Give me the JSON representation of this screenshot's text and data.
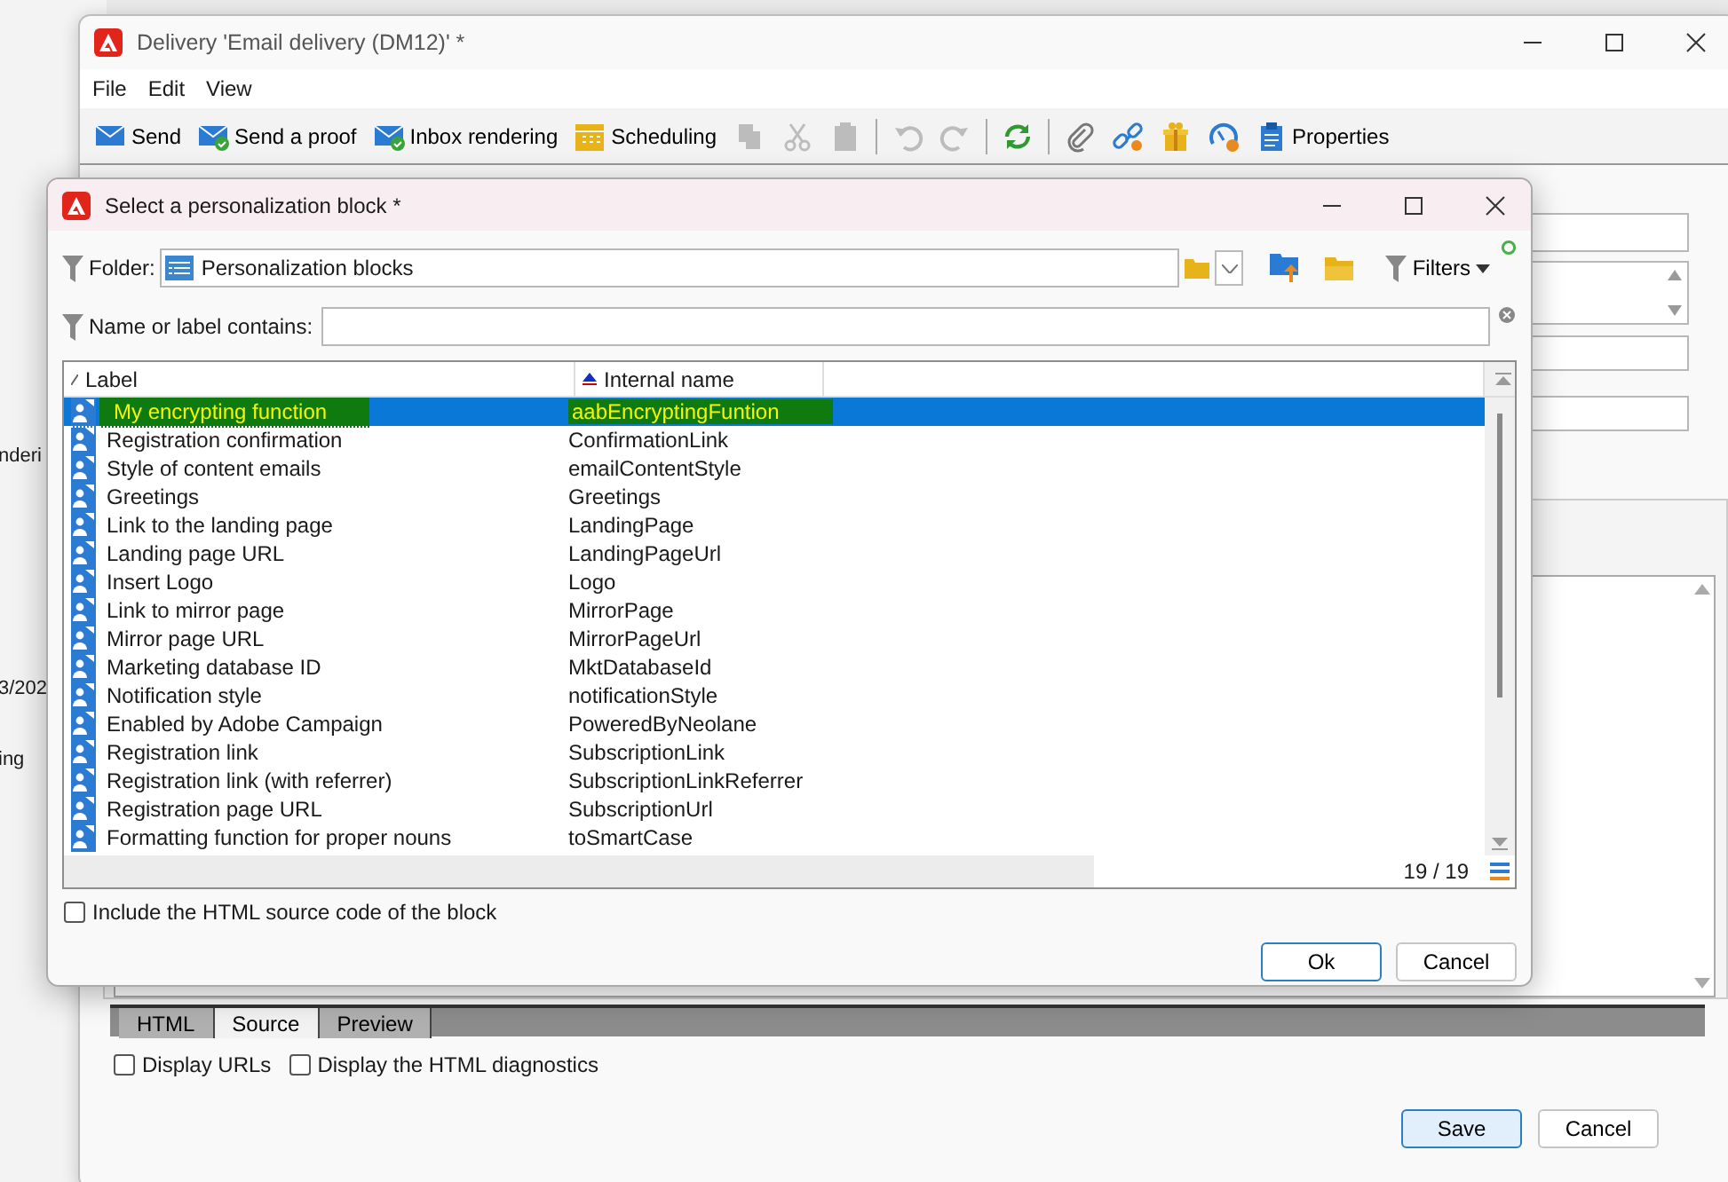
{
  "left_window": {
    "fragments": [
      "nderi",
      "3/202",
      "ing"
    ]
  },
  "main_window": {
    "title": "Delivery 'Email delivery (DM12)' *",
    "menu": [
      "File",
      "Edit",
      "View"
    ],
    "toolbar": [
      {
        "kind": "send",
        "label": "Send",
        "disabled": false
      },
      {
        "kind": "proof",
        "label": "Send a proof",
        "disabled": false
      },
      {
        "kind": "inbox",
        "label": "Inbox rendering",
        "disabled": false
      },
      {
        "kind": "schedule",
        "label": "Scheduling",
        "disabled": false
      },
      {
        "kind": "copy",
        "disabled": true
      },
      {
        "kind": "cut",
        "disabled": true
      },
      {
        "kind": "paste",
        "disabled": true
      },
      {
        "kind": "separator"
      },
      {
        "kind": "undo",
        "disabled": true
      },
      {
        "kind": "redo",
        "disabled": true
      },
      {
        "kind": "separator"
      },
      {
        "kind": "refresh",
        "disabled": false
      },
      {
        "kind": "separator"
      },
      {
        "kind": "attach",
        "disabled": false
      },
      {
        "kind": "link",
        "disabled": false
      },
      {
        "kind": "gift",
        "disabled": false
      },
      {
        "kind": "gauge",
        "disabled": false
      },
      {
        "kind": "properties",
        "label": "Properties",
        "disabled": false
      }
    ],
    "editor_tabs": [
      {
        "label": "HTML",
        "selected": false
      },
      {
        "label": "Source",
        "selected": true
      },
      {
        "label": "Preview",
        "selected": false
      }
    ],
    "options": [
      {
        "label": "Display URLs",
        "checked": false
      },
      {
        "label": "Display the HTML diagnostics",
        "checked": false
      }
    ],
    "buttons": [
      {
        "label": "Save",
        "default": true
      },
      {
        "label": "Cancel",
        "default": false
      }
    ]
  },
  "dialog": {
    "title": "Select a personalization block *",
    "folder_label": "Folder:",
    "folder_value": "Personalization blocks",
    "filters_label": "Filters",
    "search_label": "Name or label contains:",
    "columns": [
      "Label",
      "Internal name"
    ],
    "rows": [
      {
        "label": "My encrypting function",
        "internal_name": "aabEncryptingFuntion",
        "selected": true
      },
      {
        "label": "Registration confirmation",
        "internal_name": "ConfirmationLink",
        "selected": false
      },
      {
        "label": "Style of content emails",
        "internal_name": "emailContentStyle",
        "selected": false
      },
      {
        "label": "Greetings",
        "internal_name": "Greetings",
        "selected": false
      },
      {
        "label": "Link to the landing page",
        "internal_name": "LandingPage",
        "selected": false
      },
      {
        "label": "Landing page URL",
        "internal_name": "LandingPageUrl",
        "selected": false
      },
      {
        "label": "Insert Logo",
        "internal_name": "Logo",
        "selected": false
      },
      {
        "label": "Link to mirror page",
        "internal_name": "MirrorPage",
        "selected": false
      },
      {
        "label": "Mirror page URL",
        "internal_name": "MirrorPageUrl",
        "selected": false
      },
      {
        "label": "Marketing database ID",
        "internal_name": "MktDatabaseId",
        "selected": false
      },
      {
        "label": "Notification style",
        "internal_name": "notificationStyle",
        "selected": false
      },
      {
        "label": "Enabled by Adobe Campaign",
        "internal_name": "PoweredByNeolane",
        "selected": false
      },
      {
        "label": "Registration link",
        "internal_name": "SubscriptionLink",
        "selected": false
      },
      {
        "label": "Registration link (with referrer)",
        "internal_name": "SubscriptionLinkReferrer",
        "selected": false
      },
      {
        "label": "Registration page URL",
        "internal_name": "SubscriptionUrl",
        "selected": false
      },
      {
        "label": "Formatting function for proper nouns",
        "internal_name": "toSmartCase",
        "selected": false
      }
    ],
    "count": "19 / 19",
    "include_option": {
      "label": "Include the HTML source code of the block",
      "checked": false
    },
    "buttons": [
      {
        "label": "Ok",
        "default": true
      },
      {
        "label": "Cancel",
        "default": false
      }
    ]
  }
}
